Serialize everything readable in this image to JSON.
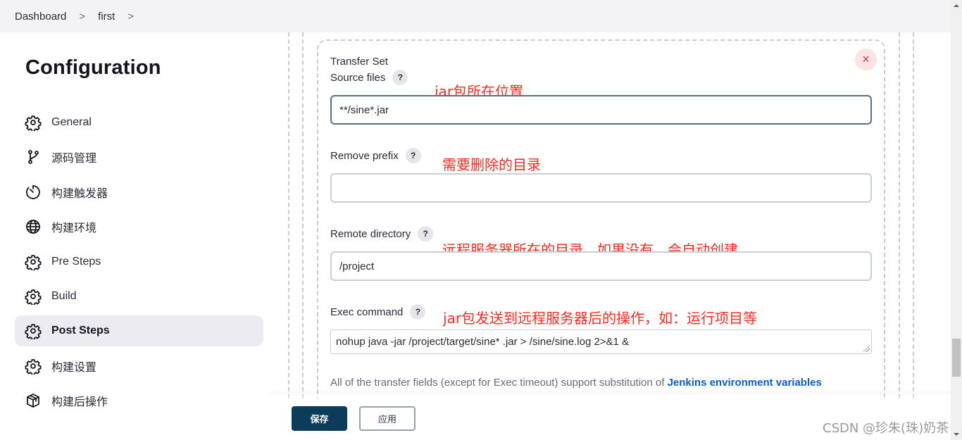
{
  "breadcrumb": {
    "items": [
      "Dashboard",
      "first"
    ],
    "separator": ">"
  },
  "page": {
    "title": "Configuration"
  },
  "sidebar": {
    "items": [
      {
        "label": "General",
        "icon": "gear-icon",
        "active": false
      },
      {
        "label": "源码管理",
        "icon": "source-branch-icon",
        "active": false
      },
      {
        "label": "构建触发器",
        "icon": "timer-icon",
        "active": false
      },
      {
        "label": "构建环境",
        "icon": "globe-icon",
        "active": false
      },
      {
        "label": "Pre Steps",
        "icon": "gear-icon",
        "active": false
      },
      {
        "label": "Build",
        "icon": "gear-icon",
        "active": false
      },
      {
        "label": "Post Steps",
        "icon": "gear-icon",
        "active": true
      },
      {
        "label": "构建设置",
        "icon": "gear-icon",
        "active": false
      },
      {
        "label": "构建后操作",
        "icon": "package-icon",
        "active": false
      }
    ]
  },
  "transfer_set": {
    "title": "Transfer Set",
    "close_icon": "×",
    "help_icon": "?",
    "source_files": {
      "label": "Source files",
      "value": "**/sine*.jar"
    },
    "remove_prefix": {
      "label": "Remove prefix",
      "value": ""
    },
    "remote_directory": {
      "label": "Remote directory",
      "value": "/project"
    },
    "exec_command": {
      "label": "Exec command",
      "value": "nohup java -jar /project/target/sine* .jar > /sine/sine.log 2>&1 &"
    },
    "note_text": "All of the transfer fields (except for Exec timeout) support substitution of ",
    "note_link": "Jenkins environment variables"
  },
  "annotations": {
    "source_files": "jar包所在位置",
    "remove_prefix": "需要删除的目录",
    "remote_directory": "远程服务器所在的目录，如果没有，会自动创建",
    "exec_command": "jar包发送到远程服务器后的操作，如：运行项目等"
  },
  "actions": {
    "save_label": "保存",
    "apply_label": "应用"
  },
  "watermark": "CSDN @珍朱(珠)奶茶"
}
